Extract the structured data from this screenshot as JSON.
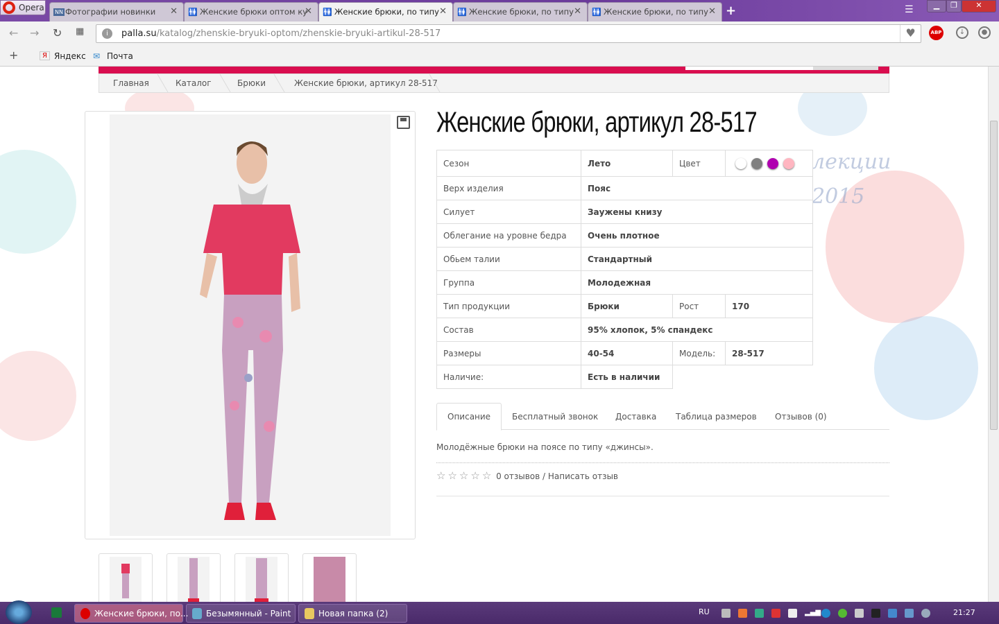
{
  "browser": {
    "menu_label": "Opera",
    "tabs": [
      {
        "title": "Фотографии новинки",
        "active": false
      },
      {
        "title": "Женские брюки оптом ку",
        "active": false
      },
      {
        "title": "Женские брюки, по типу",
        "active": true
      },
      {
        "title": "Женские брюки, по типу",
        "active": false
      },
      {
        "title": "Женские брюки, по типу",
        "active": false
      }
    ],
    "url_host": "palla.su",
    "url_path": "/katalog/zhenskie-bryuki-optom/zhenskie-bryuki-artikul-28-517",
    "adblock_label": "ABP",
    "bookmarks": [
      "Яндекс",
      "Почта"
    ]
  },
  "breadcrumb": [
    "Главная",
    "Каталог",
    "Брюки",
    "Женские брюки, артикул 28-517"
  ],
  "product": {
    "title": "Женские брюки, артикул 28-517",
    "watermark": [
      "лекции",
      "2015"
    ],
    "specs": {
      "season_label": "Сезон",
      "season": "Лето",
      "color_label": "Цвет",
      "colors": [
        "#ffffff",
        "#808080",
        "#b000b0",
        "#ffb6c1"
      ],
      "top_label": "Верх изделия",
      "top": "Пояс",
      "silhouette_label": "Силует",
      "silhouette": "Заужены книзу",
      "fit_label": "Облегание на уровне бедра",
      "fit": "Очень плотное",
      "waist_label": "Обьем талии",
      "waist": "Стандартный",
      "group_label": "Группа",
      "group": "Молодежная",
      "type_label": "Тип продукции",
      "type": "Брюки",
      "height_label": "Рост",
      "height": "170",
      "composition_label": "Состав",
      "composition": "95% хлопок, 5% спандекс",
      "sizes_label": "Размеры",
      "sizes": "40-54",
      "model_label": "Модель:",
      "model": "28-517",
      "availability_label": "Наличие:",
      "availability": "Есть в наличии"
    },
    "tabs": [
      "Описание",
      "Бесплатный звонок",
      "Доставка",
      "Таблица размеров",
      "Отзывов (0)"
    ],
    "description": "Молодёжные брюки на поясе по типу «джинсы».",
    "rating": 0,
    "reviews_text": "0 отзывов / Написать отзыв"
  },
  "taskbar": {
    "tasks": [
      "Женские брюки, по...",
      "Безымянный - Paint",
      "Новая папка (2)"
    ],
    "lang": "RU",
    "time": "21:27"
  },
  "colors": {
    "accent": "#d90e4f",
    "browser": "#6a3a9a"
  }
}
